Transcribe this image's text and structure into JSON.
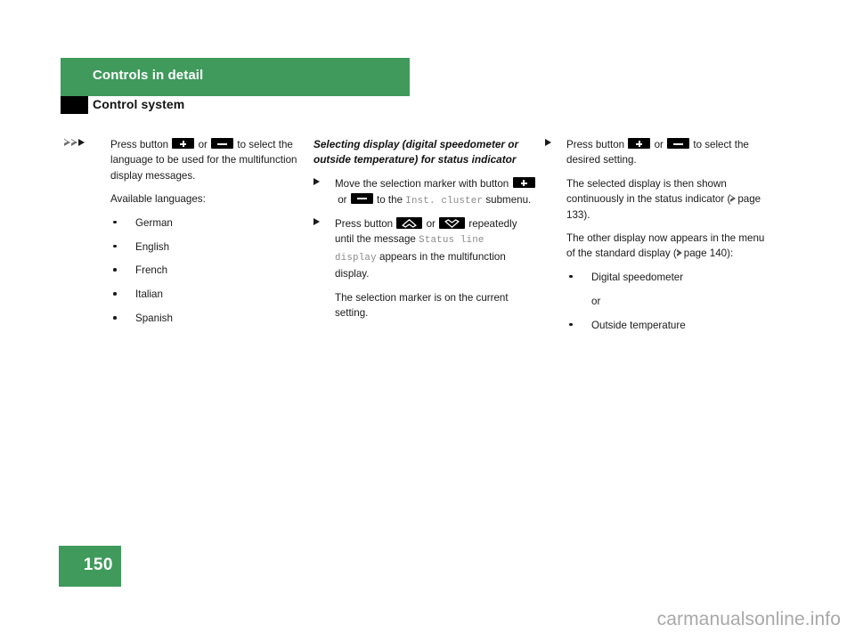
{
  "header": {
    "chapter": "Controls in detail",
    "section": "Control system"
  },
  "columns": {
    "left": {
      "step1": {
        "text_before_btn1": "Press button",
        "btn1": "plus-button",
        "or": "or",
        "btn2": "minus-button",
        "text_after": "to select the language to be used for the multifunction display messages."
      },
      "available_label": "Available languages:",
      "languages": [
        "German",
        "English",
        "French",
        "Italian",
        "Spanish"
      ]
    },
    "middle": {
      "heading": "Selecting display (digital speedometer or outside temperature) for status indicator",
      "step1": {
        "lead": "Move the selection marker with button",
        "or": "or",
        "mid": "to the",
        "mono1": "Inst. cluster",
        "tail": "submenu."
      },
      "step2": {
        "lead": "Press button",
        "or": "or",
        "mid": "repeatedly until the message",
        "mono1": "Status line display",
        "tail": "appears in the multifunction display."
      },
      "note": "The selection marker is on the current setting."
    },
    "right": {
      "step1": {
        "lead": "Press button",
        "or": "or",
        "tail": "to select the desired setting."
      },
      "para1_before_ref": "The selected display is then shown continuously in the status indicator (",
      "para1_ref": "page 133",
      "para1_after_ref": ").",
      "para2_before_ref": "The other display now appears in the menu of the standard display (",
      "para2_ref": "page 140",
      "para2_after_ref": "):",
      "options": [
        "Digital speedometer",
        "Outside temperature"
      ],
      "or_between": "or"
    }
  },
  "footer": {
    "page_number": "150",
    "watermark": "carmanualsonline.info"
  },
  "colors": {
    "accent_green": "#3f9a5c",
    "mono_gray": "#8a8a8a",
    "watermark_gray": "#a8a8a8"
  }
}
